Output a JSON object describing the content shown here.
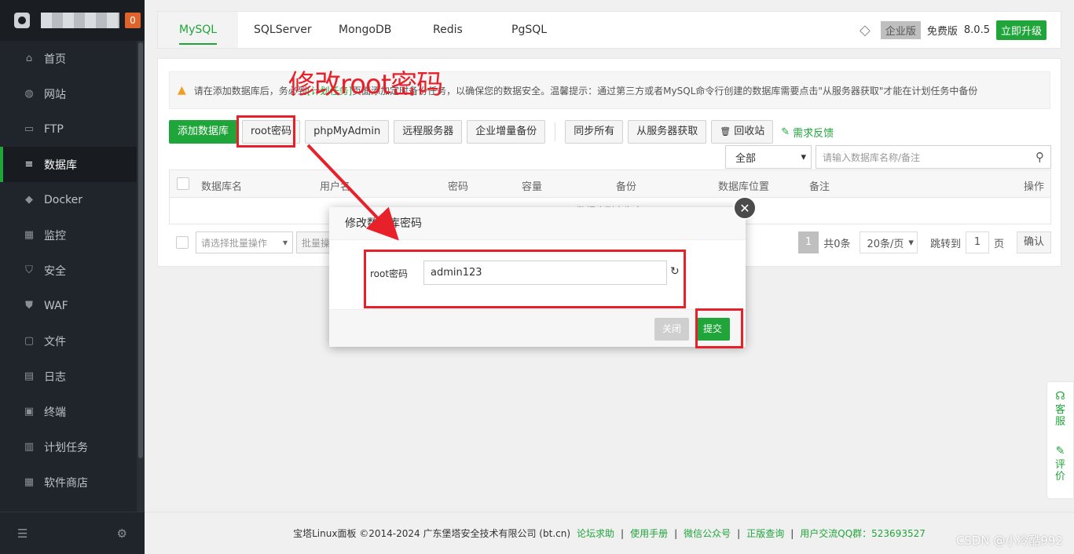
{
  "badge_count": "0",
  "sidebar": {
    "items": [
      {
        "label": "首页",
        "icon": "home-icon",
        "glyph": "⌂"
      },
      {
        "label": "网站",
        "icon": "globe-icon",
        "glyph": "◍"
      },
      {
        "label": "FTP",
        "icon": "ftp-icon",
        "glyph": "▭"
      },
      {
        "label": "数据库",
        "icon": "database-icon",
        "glyph": "≡",
        "active": true
      },
      {
        "label": "Docker",
        "icon": "docker-icon",
        "glyph": "◆"
      },
      {
        "label": "监控",
        "icon": "monitor-icon",
        "glyph": "▦"
      },
      {
        "label": "安全",
        "icon": "shield-icon",
        "glyph": "⛉"
      },
      {
        "label": "WAF",
        "icon": "waf-icon",
        "glyph": "⛊"
      },
      {
        "label": "文件",
        "icon": "folder-icon",
        "glyph": "▢"
      },
      {
        "label": "日志",
        "icon": "log-icon",
        "glyph": "▤"
      },
      {
        "label": "终端",
        "icon": "terminal-icon",
        "glyph": "▣"
      },
      {
        "label": "计划任务",
        "icon": "schedule-icon",
        "glyph": "▥"
      },
      {
        "label": "软件商店",
        "icon": "store-icon",
        "glyph": "▦"
      }
    ]
  },
  "tabs": [
    "MySQL",
    "SQLServer",
    "MongoDB",
    "Redis",
    "PgSQL"
  ],
  "edition": {
    "enterprise": "企业版",
    "free": "免费版",
    "version": "8.0.5",
    "upgrade": "立即升级"
  },
  "warning": {
    "text1": "请在添加数据库后，务必到",
    "link": "[计划任务]",
    "text2": "页面添加定时备份任务，以确保您的数据安全。温馨提示：通过第三方或者MySQL命令行创建的数据库需要点击\"从服务器获取\"才能在计划任务中备份"
  },
  "toolbar": {
    "add_db": "添加数据库",
    "root_pwd": "root密码",
    "phpmyadmin": "phpMyAdmin",
    "remote": "远程服务器",
    "enterprise_backup": "企业增量备份",
    "sync_all": "同步所有",
    "fetch": "从服务器获取",
    "recycle": "回收站",
    "feedback": "需求反馈"
  },
  "filter": {
    "selected": "全部",
    "search_placeholder": "请输入数据库名称/备注"
  },
  "table": {
    "headers": [
      "数据库名",
      "用户名",
      "密码",
      "容量",
      "备份",
      "数据库位置",
      "备注",
      "操作"
    ],
    "empty": "数据库列表为空"
  },
  "batch": {
    "placeholder": "请选择批量操作",
    "execute": "批量操作"
  },
  "pager": {
    "current": "1",
    "total": "共0条",
    "per_page": "20条/页",
    "jump": "跳转到",
    "page_input": "1",
    "page_unit": "页",
    "confirm": "确认"
  },
  "modal": {
    "title": "修改数据库密码",
    "label": "root密码",
    "value": "admin123",
    "close": "关闭",
    "submit": "提交"
  },
  "annotation": {
    "title": "修改root密码"
  },
  "footer": {
    "copyright": "宝塔Linux面板 ©2014-2024 广东堡塔安全技术有限公司 (bt.cn)",
    "links": [
      "论坛求助",
      "使用手册",
      "微信公众号",
      "正版查询",
      "用户交流QQ群：523693527"
    ]
  },
  "float_service": {
    "service": "客服",
    "rate": "评价"
  },
  "watermark": "CSDN @小冷酷992",
  "colors": {
    "accent": "#20a53a",
    "annotation": "#e8202a",
    "sidebar": "#20252b"
  }
}
